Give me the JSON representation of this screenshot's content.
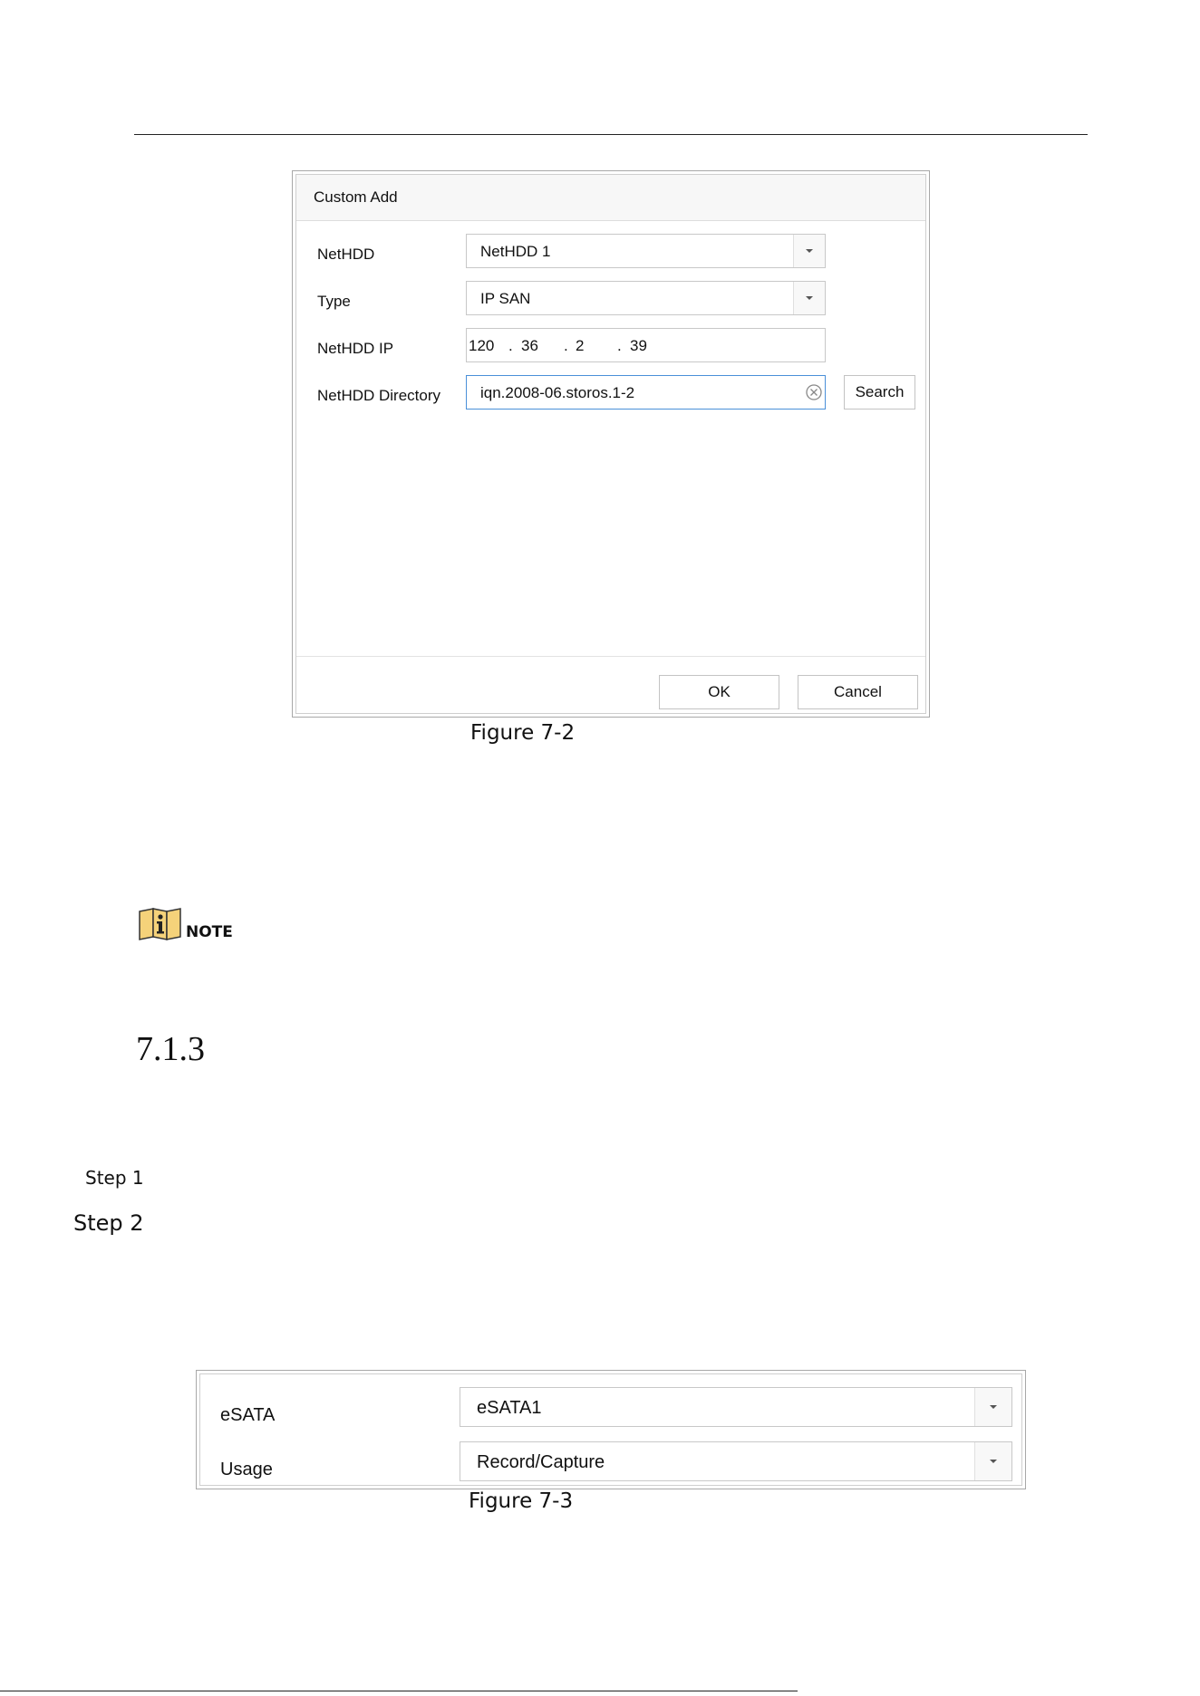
{
  "custom_add_dialog": {
    "title": "Custom Add",
    "fields": {
      "nethdd": {
        "label": "NetHDD",
        "value": "NetHDD 1"
      },
      "type": {
        "label": "Type",
        "value": "IP SAN"
      },
      "nethdd_ip": {
        "label": "NetHDD IP",
        "octets": [
          "120",
          "36",
          "2",
          "39"
        ],
        "separator": "."
      },
      "nethdd_directory": {
        "label": "NetHDD Directory",
        "value": "iqn.2008-06.storos.1-2"
      }
    },
    "search_button": "Search",
    "ok_button": "OK",
    "cancel_button": "Cancel",
    "caption": "Figure 7-2"
  },
  "note": {
    "icon": "info-icon",
    "label": "NOTE"
  },
  "section": {
    "number": "7.1.3"
  },
  "steps": {
    "step1": "Step 1",
    "step2": "Step 2"
  },
  "esata_panel": {
    "esata": {
      "label": "eSATA",
      "value": "eSATA1"
    },
    "usage": {
      "label": "Usage",
      "value": "Record/Capture"
    },
    "caption": "Figure 7-3"
  },
  "colors": {
    "focus_border": "#4a90d9",
    "note_icon_fill": "#f5d27a"
  }
}
